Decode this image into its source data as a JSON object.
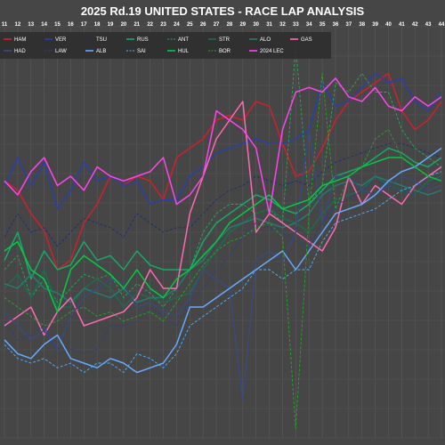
{
  "chart_data": {
    "type": "line",
    "title": "2025 Rd.19 UNITED STATES - RACE LAP ANALYSIS",
    "xlabel": "",
    "ylabel": "",
    "grid": true,
    "legend_position": "top-left",
    "x": [
      11,
      12,
      13,
      14,
      15,
      16,
      17,
      18,
      19,
      20,
      21,
      22,
      23,
      24,
      25,
      26,
      27,
      28,
      29,
      30,
      31,
      32,
      33,
      34,
      35,
      36,
      37,
      38,
      39,
      40,
      41,
      42,
      43,
      44
    ],
    "series": [
      {
        "name": "HAM",
        "color": "#d0202a",
        "dash": "solid",
        "values": [
          205,
          215,
          240,
          258,
          300,
          290,
          250,
          230,
          200,
          210,
          200,
          205,
          225,
          180,
          170,
          160,
          140,
          135,
          140,
          120,
          125,
          165,
          200,
          195,
          170,
          140,
          120,
          110,
          100,
          90,
          130,
          150,
          140,
          120
        ]
      },
      {
        "name": "VER",
        "color": "#2a3fa8",
        "dash": "solid",
        "values": [
          210,
          180,
          210,
          185,
          235,
          215,
          185,
          205,
          200,
          210,
          205,
          230,
          225,
          225,
          200,
          190,
          175,
          170,
          165,
          160,
          165,
          165,
          160,
          150,
          100,
          125,
          120,
          105,
          90,
          100,
          95,
          120,
          130,
          110
        ]
      },
      {
        "name": "TSU",
        "color": "#1c2c78",
        "dash": "dashed",
        "values": [
          265,
          240,
          260,
          255,
          275,
          260,
          245,
          250,
          255,
          265,
          240,
          250,
          260,
          255,
          255,
          240,
          225,
          215,
          210,
          200,
          205,
          210,
          205,
          210,
          195,
          185,
          180,
          175,
          170,
          165,
          165,
          170,
          175,
          180
        ]
      },
      {
        "name": "RUS",
        "color": "#18a86a",
        "dash": "solid",
        "values": [
          290,
          260,
          310,
          280,
          300,
          295,
          270,
          290,
          285,
          300,
          280,
          295,
          300,
          300,
          300,
          270,
          250,
          240,
          230,
          220,
          225,
          235,
          240,
          230,
          215,
          200,
          195,
          190,
          180,
          170,
          175,
          185,
          190,
          180
        ]
      },
      {
        "name": "ANT",
        "color": "#2aaa55",
        "dash": "dashed",
        "values": [
          300,
          285,
          330,
          310,
          335,
          320,
          305,
          310,
          305,
          330,
          315,
          325,
          340,
          320,
          300,
          260,
          240,
          230,
          230,
          240,
          235,
          250,
          60,
          230,
          210,
          100,
          110,
          90,
          110,
          110,
          150,
          170,
          180,
          190
        ]
      },
      {
        "name": "STR",
        "color": "#1d6b4e",
        "dash": "solid",
        "values": [
          320,
          305,
          330,
          300,
          340,
          340,
          320,
          310,
          320,
          340,
          325,
          330,
          335,
          330,
          325,
          300,
          280,
          260,
          250,
          240,
          235,
          245,
          250,
          260,
          240,
          225,
          220,
          215,
          200,
          210,
          215,
          220,
          205,
          200
        ]
      },
      {
        "name": "ALO",
        "color": "#287a6e",
        "dash": "solid",
        "values": [
          315,
          320,
          305,
          320,
          325,
          335,
          320,
          325,
          330,
          320,
          335,
          330,
          330,
          320,
          300,
          290,
          270,
          255,
          250,
          245,
          250,
          255,
          250,
          240,
          220,
          210,
          205,
          210,
          200,
          205,
          210,
          215,
          220,
          215
        ]
      },
      {
        "name": "GAS",
        "color": "#ff69b4",
        "dash": "solid",
        "values": [
          360,
          350,
          340,
          370,
          345,
          330,
          360,
          355,
          350,
          345,
          330,
          300,
          320,
          320,
          240,
          200,
          160,
          140,
          120,
          260,
          240,
          250,
          260,
          270,
          280,
          255,
          200,
          230,
          210,
          220,
          230,
          210,
          200,
          190
        ]
      },
      {
        "name": "HAD",
        "color": "#3a4a7a",
        "dash": "solid",
        "values": [
          345,
          360,
          375,
          365,
          385,
          350,
          330,
          320,
          310,
          315,
          340,
          335,
          345,
          350,
          330,
          300,
          310,
          320,
          440,
          290,
          280,
          290,
          260,
          150,
          250,
          200,
          200,
          215,
          220,
          210,
          200,
          205,
          215,
          210
        ]
      },
      {
        "name": "LAW",
        "color": "#2c3e8a",
        "dash": "dashed",
        "values": [
          355,
          375,
          370,
          360,
          390,
          385,
          390,
          385,
          360,
          360,
          355,
          340,
          350,
          360,
          335,
          320,
          300,
          285,
          265,
          250,
          255,
          260,
          270,
          275,
          250,
          230,
          225,
          215,
          205,
          210,
          215,
          220,
          210,
          200
        ]
      },
      {
        "name": "ALB",
        "color": "#66aaff",
        "dash": "solid",
        "values": [
          375,
          390,
          395,
          380,
          370,
          395,
          400,
          405,
          395,
          400,
          410,
          405,
          400,
          380,
          340,
          340,
          330,
          320,
          310,
          300,
          290,
          280,
          300,
          280,
          260,
          240,
          235,
          230,
          220,
          205,
          195,
          190,
          180,
          170
        ]
      },
      {
        "name": "SAI",
        "color": "#4db3ff",
        "dash": "dashed",
        "values": [
          380,
          395,
          400,
          395,
          405,
          400,
          410,
          400,
          400,
          410,
          390,
          395,
          405,
          390,
          360,
          350,
          340,
          330,
          320,
          300,
          300,
          310,
          300,
          300,
          270,
          250,
          245,
          240,
          235,
          225,
          215,
          210,
          200,
          195
        ]
      },
      {
        "name": "HUL",
        "color": "#00cc44",
        "dash": "solid",
        "values": [
          280,
          270,
          300,
          310,
          345,
          300,
          285,
          295,
          305,
          320,
          300,
          320,
          330,
          310,
          300,
          285,
          270,
          250,
          240,
          230,
          220,
          235,
          230,
          225,
          210,
          205,
          200,
          190,
          185,
          180,
          180,
          190,
          200,
          205
        ]
      },
      {
        "name": "BOR",
        "color": "#22aa22",
        "dash": "dashed",
        "values": [
          330,
          340,
          350,
          360,
          355,
          345,
          340,
          350,
          345,
          355,
          350,
          345,
          355,
          335,
          315,
          295,
          280,
          270,
          265,
          255,
          250,
          265,
          470,
          240,
          90,
          235,
          200,
          190,
          160,
          150,
          180,
          190,
          200,
          205
        ]
      },
      {
        "name": "2024 LEC",
        "color": "#ff44ee",
        "dash": "solid",
        "values": [
          205,
          220,
          195,
          180,
          210,
          200,
          215,
          190,
          200,
          205,
          200,
          195,
          180,
          230,
          220,
          200,
          130,
          140,
          150,
          170,
          240,
          150,
          110,
          105,
          110,
          95,
          115,
          120,
          105,
          125,
          130,
          115,
          125,
          115
        ]
      }
    ]
  }
}
